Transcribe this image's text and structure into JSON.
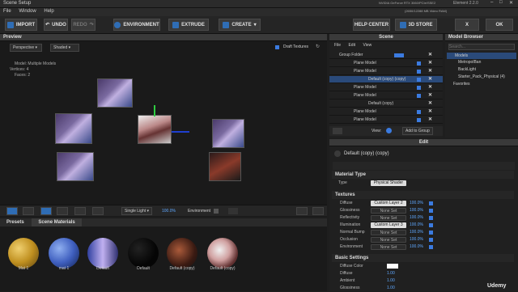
{
  "window": {
    "title": "Scene Setup",
    "gpu_line1": "NVIDIA GeForce RTX 3060/PCIe/SSE2",
    "gpu_line2": "(2650/12288 MB Video RAM)",
    "element": "Element 2.2.0"
  },
  "menu": [
    "File",
    "Window",
    "Help"
  ],
  "toolbar": {
    "import": "IMPORT",
    "undo": "UNDO",
    "redo": "REDO",
    "environment": "ENVIRONMENT",
    "extrude": "EXTRUDE",
    "create": "CREATE",
    "help": "HELP CENTER",
    "store": "3D STORE",
    "cancel": "X",
    "ok": "OK"
  },
  "preview": {
    "title": "Preview",
    "camera": "Perspective",
    "shading": "Shaded",
    "draft": "Draft Textures",
    "model_label": "Model:",
    "model_value": "Multiple Models",
    "vertices_label": "Vertices:",
    "vertices_value": "4",
    "faces_label": "Faces:",
    "faces_value": "2"
  },
  "viewport_bottom": {
    "light": "Single Light",
    "light_value": "100.0%",
    "environment": "Environment"
  },
  "materials": {
    "tabs": [
      "Presets",
      "Scene Materials"
    ],
    "items": [
      "Mat 1",
      "mat 1",
      "Default",
      "Default",
      "Default (copy)",
      "Default (copy)"
    ]
  },
  "scene": {
    "title": "Scene",
    "menu": [
      "File",
      "Edit",
      "View"
    ],
    "rows": [
      "Group Folder",
      "Plane Model",
      "Plane Model",
      "Default (copy) (copy)",
      "Plane Model",
      "Plane Model",
      "Default (copy)",
      "Plane Model",
      "Plane Model"
    ],
    "view_label": "View:",
    "add_group": "Add to Group"
  },
  "browser": {
    "title": "Model Browser",
    "search": "Search...",
    "items": [
      "Models",
      "MetropolBan",
      "BackLight",
      "Starter_Pack_Physical (4)",
      "Favorites"
    ]
  },
  "edit": {
    "title": "Edit",
    "material_name": "Default (copy) (copy)",
    "material_type_label": "Material Type",
    "type_label": "Type",
    "type_value": "Physical Shader",
    "textures_label": "Textures",
    "basic_label": "Basic Settings",
    "textures": [
      {
        "name": "Diffuse",
        "btn": "Custom Layer 2",
        "val": "100.0%"
      },
      {
        "name": "Glossiness",
        "btn": "None Set",
        "val": "100.0%"
      },
      {
        "name": "Reflectivity",
        "btn": "None Set",
        "val": "100.0%"
      },
      {
        "name": "Illumination",
        "btn": "Custom Layer 3",
        "val": "100.0%"
      },
      {
        "name": "Normal Bump",
        "btn": "None Set",
        "val": "100.0%"
      },
      {
        "name": "Occlusion",
        "btn": "None Set",
        "val": "100.0%"
      },
      {
        "name": "Environment",
        "btn": "None Set",
        "val": "100.0%"
      }
    ],
    "basic": [
      {
        "name": "Diffuse Color",
        "val": ""
      },
      {
        "name": "Diffuse",
        "val": "1.00"
      },
      {
        "name": "Ambient",
        "val": "1.00"
      },
      {
        "name": "Glossiness",
        "val": "1.00"
      }
    ]
  },
  "watermark": "Udemy"
}
